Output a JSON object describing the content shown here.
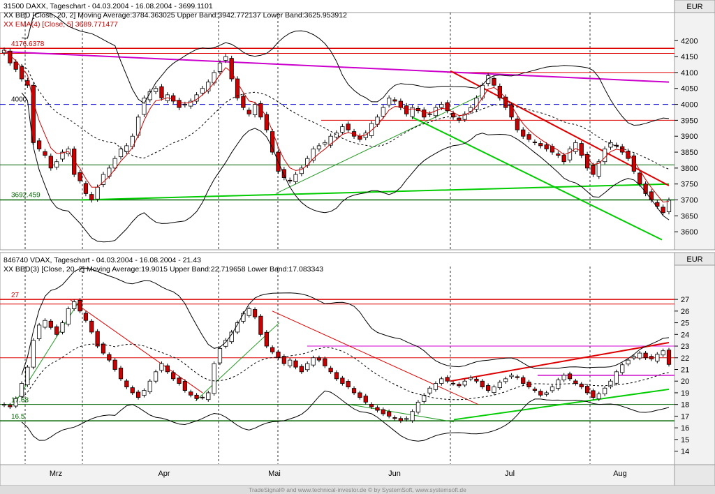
{
  "colors": {
    "background": "#ffffff",
    "axis_bg": "#e8e8e8",
    "candle_up": "#ffffff",
    "candle_down": "#cc0000",
    "ema": "#cc0000",
    "bands": "#000000",
    "ma_dashed": "#000000",
    "support_green": "#00cc00",
    "dark_green": "#006600",
    "resistance_red": "#dd0000",
    "magenta": "#cc00cc",
    "blue_dashed": "#0000cc",
    "header_text": "#000000",
    "header_red": "#cc0000"
  },
  "footer_text": "TradeSignal® and www.technical-investor.de © by SystemSoft, www.systemsoft.de",
  "x_axis": {
    "month_labels": [
      "Mrz",
      "Apr",
      "Mai",
      "Jun",
      "Jul",
      "Aug"
    ],
    "n_bars": 115
  },
  "chart_data": [
    {
      "type": "candlestick",
      "header_line1": "31500  DAXX, Tageschart - 04.03.2004 - 16.08.2004 - 3699.1101",
      "header_line2": "XX BBD [Close, 20, 2] Moving Average:3784.363025 Upper Band:3942.772137 Lower Band:3625.953912",
      "header_line3": "XX EMA(4) [Close, 5] 3689.771477",
      "currency": "EUR",
      "ylim": [
        3550,
        4240
      ],
      "yticks": [
        3600,
        3650,
        3700,
        3750,
        3800,
        3850,
        3900,
        3950,
        4000,
        4050,
        4100,
        4150,
        4200
      ],
      "level_labels": [
        "4176.6378",
        "4000",
        "3692.459"
      ],
      "close": [
        4170,
        4130,
        4110,
        4080,
        4060,
        3880,
        3860,
        3840,
        3800,
        3820,
        3850,
        3860,
        3780,
        3760,
        3720,
        3700,
        3740,
        3780,
        3800,
        3830,
        3860,
        3870,
        3900,
        3960,
        4020,
        4040,
        4050,
        4020,
        4030,
        4010,
        3990,
        4000,
        4010,
        4030,
        4050,
        4070,
        4100,
        4130,
        4150,
        4080,
        4020,
        3990,
        3970,
        4000,
        3960,
        3920,
        3850,
        3790,
        3770,
        3760,
        3780,
        3800,
        3830,
        3860,
        3870,
        3880,
        3900,
        3910,
        3930,
        3920,
        3900,
        3890,
        3910,
        3940,
        3960,
        3990,
        4020,
        4010,
        3990,
        3970,
        3990,
        3980,
        3960,
        3970,
        3990,
        4000,
        3980,
        3960,
        3950,
        3970,
        3990,
        4020,
        4060,
        4090,
        4060,
        4020,
        3990,
        3960,
        3920,
        3900,
        3890,
        3880,
        3870,
        3860,
        3850,
        3840,
        3820,
        3860,
        3880,
        3840,
        3800,
        3780,
        3820,
        3860,
        3880,
        3870,
        3850,
        3830,
        3790,
        3750,
        3720,
        3700,
        3680,
        3660,
        3699
      ]
    },
    {
      "type": "candlestick",
      "header_line1": "846740  VDAX, Tageschart - 04.03.2004 - 16.08.2004 - 21.43",
      "header_line2": "XX BBD(3) [Close, 20, 2] Moving Average:19.9015 Upper Band:22.719658 Lower Band:17.083343",
      "currency": "EUR",
      "ylim": [
        13.2,
        28.5
      ],
      "yticks": [
        14,
        15,
        16,
        17,
        18,
        19,
        20,
        21,
        22,
        23,
        24,
        25,
        26,
        27
      ],
      "level_labels": [
        "27",
        "17.68",
        "16.5"
      ],
      "close": [
        18.0,
        17.8,
        18.5,
        19.8,
        21.2,
        23.5,
        24.8,
        25.2,
        24.6,
        24.0,
        25.0,
        26.2,
        26.8,
        26.0,
        25.2,
        24.2,
        23.0,
        22.4,
        21.8,
        21.0,
        20.2,
        19.5,
        19.0,
        18.6,
        19.2,
        20.0,
        20.8,
        21.5,
        20.8,
        20.2,
        19.8,
        19.2,
        18.8,
        18.5,
        18.6,
        19.0,
        21.5,
        22.8,
        23.5,
        24.2,
        25.0,
        25.8,
        26.2,
        25.5,
        24.0,
        23.0,
        22.5,
        22.0,
        21.5,
        21.8,
        21.2,
        20.8,
        21.5,
        22.0,
        21.8,
        21.3,
        20.8,
        20.2,
        19.8,
        19.5,
        19.0,
        18.6,
        18.2,
        17.8,
        17.5,
        17.2,
        17.0,
        16.8,
        16.6,
        16.8,
        17.4,
        18.2,
        18.8,
        19.4,
        19.8,
        20.2,
        20.0,
        19.8,
        19.6,
        20.0,
        20.3,
        20.0,
        19.5,
        19.2,
        19.5,
        19.9,
        20.2,
        20.5,
        20.3,
        19.8,
        19.5,
        19.2,
        18.8,
        19.0,
        19.5,
        20.1,
        20.5,
        20.2,
        19.8,
        19.5,
        19.0,
        18.6,
        18.9,
        19.4,
        20.0,
        20.8,
        21.4,
        21.8,
        22.1,
        22.4,
        22.0,
        21.9,
        22.3,
        22.6,
        21.43
      ]
    }
  ]
}
